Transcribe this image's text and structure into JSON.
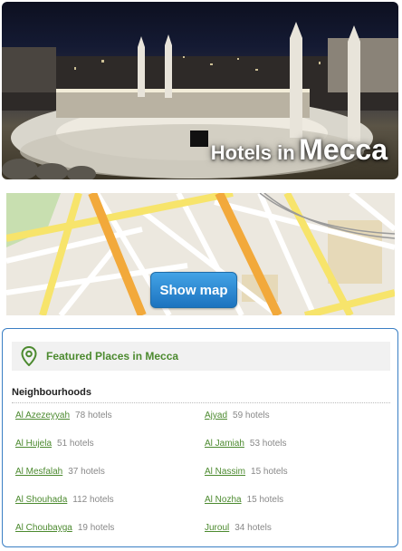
{
  "hero": {
    "title_prefix": "Hotels in",
    "title_city": "Mecca"
  },
  "map": {
    "button_label": "Show map"
  },
  "featured": {
    "title": "Featured Places in Mecca",
    "section_heading": "Neighbourhoods",
    "neighbourhoods": [
      {
        "name": "Al Azezeyyah",
        "count": "78 hotels"
      },
      {
        "name": "Ajyad",
        "count": "59 hotels"
      },
      {
        "name": "Al Hujela",
        "count": "51 hotels"
      },
      {
        "name": "Al Jamiah",
        "count": "53 hotels"
      },
      {
        "name": "Al Mesfalah",
        "count": "37 hotels"
      },
      {
        "name": "Al Nassim",
        "count": "15 hotels"
      },
      {
        "name": "Al Shouhada",
        "count": "112 hotels"
      },
      {
        "name": "Al Nozha",
        "count": "15 hotels"
      },
      {
        "name": "Al Choubayga",
        "count": "19 hotels"
      },
      {
        "name": "Juroul",
        "count": "34 hotels"
      }
    ]
  },
  "colors": {
    "link_green": "#4c8a2f",
    "box_border": "#3a7fc4",
    "button_blue": "#1c73bf"
  }
}
